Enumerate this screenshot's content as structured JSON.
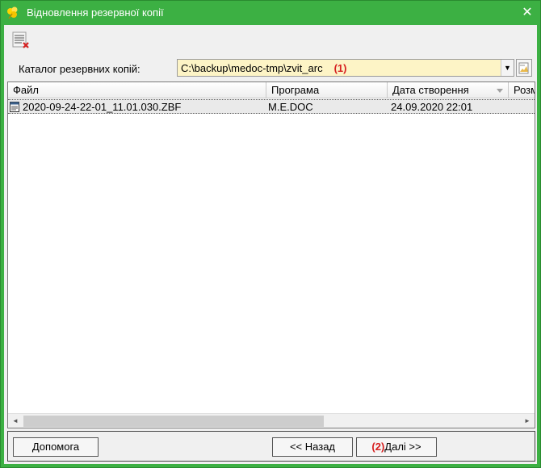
{
  "window": {
    "title": "Відновлення резервної копії",
    "close_glyph": "✕",
    "accent_color": "#3cb043"
  },
  "toolbar": {
    "delete_icon": "delete-list-icon"
  },
  "directory": {
    "label": "Каталог резервних копій:",
    "value": "C:\\backup\\medoc-tmp\\zvit_arc",
    "marker": "(1)",
    "dropdown_glyph": "▼",
    "browse_icon": "folder-browse-icon"
  },
  "grid": {
    "columns": [
      "Файл",
      "Програма",
      "Дата створення",
      "Розм"
    ],
    "rows": [
      {
        "file": "2020-09-24-22-01_11.01.030.ZBF",
        "program": "M.E.DOC",
        "created": "24.09.2020 22:01",
        "size": ""
      }
    ]
  },
  "scroll": {
    "left_glyph": "◄",
    "right_glyph": "►"
  },
  "buttons": {
    "help": "Допомога",
    "back": "<< Назад",
    "next_marker": "(2)",
    "next": "Далі >>"
  }
}
